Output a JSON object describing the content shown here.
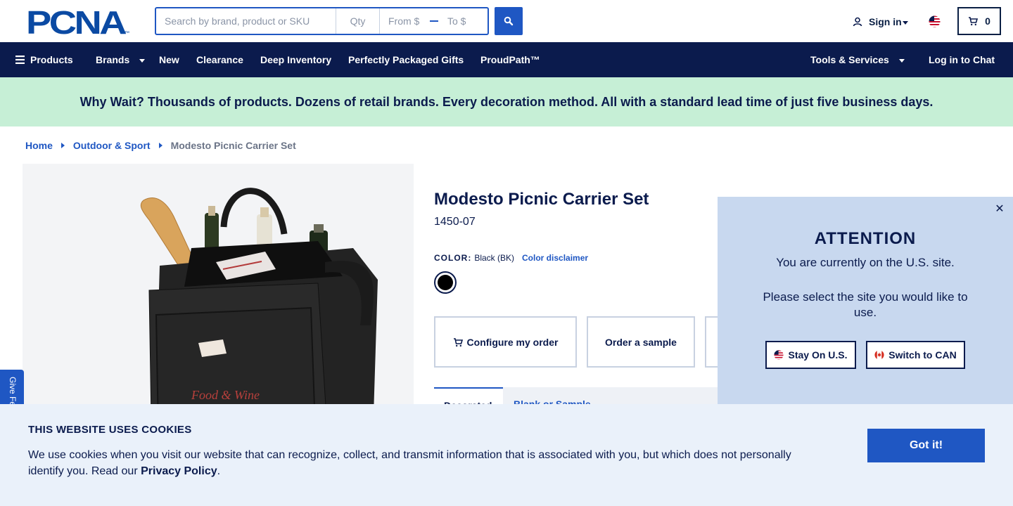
{
  "header": {
    "logo_text": "PCNA",
    "search": {
      "placeholder": "Search by brand, product or SKU",
      "qty_placeholder": "Qty",
      "from_placeholder": "From $",
      "to_placeholder": "To $"
    },
    "signin_label": "Sign in",
    "cart_count": "0"
  },
  "nav": {
    "items": [
      "Products",
      "Brands",
      "New",
      "Clearance",
      "Deep Inventory",
      "Perfectly Packaged Gifts",
      "ProudPath™"
    ],
    "tools": "Tools & Services",
    "chat": "Log in to Chat"
  },
  "promo": "Why Wait? Thousands of products. Dozens of retail brands. Every decoration method. All with a standard lead time of just five business days.",
  "breadcrumb": {
    "home": "Home",
    "category": "Outdoor & Sport",
    "current": "Modesto Picnic Carrier Set"
  },
  "product": {
    "title": "Modesto Picnic Carrier Set",
    "sku": "1450-07",
    "color_label": "COLOR:",
    "color_value": "Black (BK)",
    "color_disclaimer": "Color disclaimer",
    "swatch_color": "#000000",
    "image_print": "Food & Wine"
  },
  "actions": {
    "configure": "Configure my order",
    "sample": "Order a sample"
  },
  "tabs": {
    "active": "Decorated",
    "inactive": "Blank or Sample"
  },
  "feedback": "Give Feedback",
  "attention": {
    "title": "ATTENTION",
    "line1": "You are currently on the U.S. site.",
    "line2": "Please select the site you would like to use.",
    "stay": "Stay On U.S.",
    "switch": "Switch to CAN"
  },
  "cookie": {
    "title": "THIS WEBSITE USES COOKIES",
    "text": "We use cookies when you visit our website that can recognize, collect, and transmit information that is associated with you, but which does not personally identify you. Read our ",
    "link": "Privacy Policy",
    "end": ".",
    "button": "Got it!"
  },
  "colors": {
    "brand_blue": "#1f57c3",
    "navy": "#0b1b4d",
    "promo_green": "#c6efd6",
    "modal_bg": "#c8d8ef",
    "cookie_bg": "#eaf1fa"
  }
}
